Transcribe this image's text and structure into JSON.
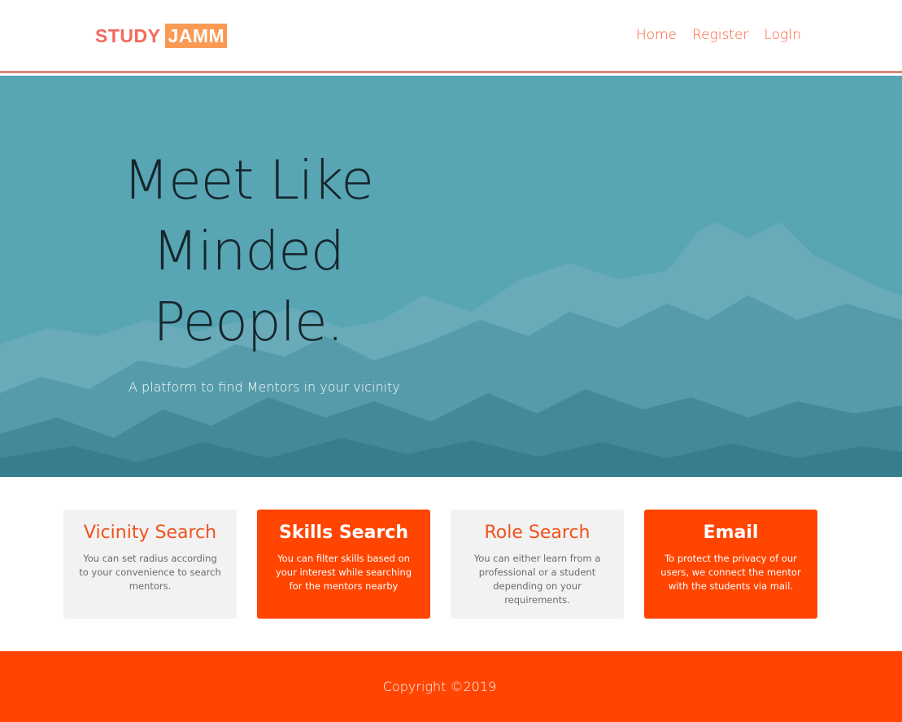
{
  "header": {
    "logo": {
      "part1": "STUDY",
      "part2": "JAMM"
    },
    "nav": [
      {
        "label": "Home"
      },
      {
        "label": "Register"
      },
      {
        "label": "LogIn"
      }
    ]
  },
  "hero": {
    "title_lines": [
      "Meet Like",
      "Minded",
      "People."
    ],
    "subtitle": "A platform to find Mentors in your vicinity"
  },
  "features": [
    {
      "title": "Vicinity Search",
      "text": "You can set radius according to your convenience to search mentors.",
      "style": "light"
    },
    {
      "title": "Skills Search",
      "text": "You can filter skills based on your interest while searching for the mentors nearby",
      "style": "orange"
    },
    {
      "title": "Role Search",
      "text": "You can either learn from a professional or a student depending on your requirements.",
      "style": "light"
    },
    {
      "title": "Email",
      "text": "To protect the privacy of our users, we connect the mentor with the students via mail.",
      "style": "orange"
    }
  ],
  "footer": {
    "copyright": "Copyright ©2019"
  },
  "colors": {
    "accent": "#ff4500",
    "hero_bg": "#58a5b4",
    "logo_study": "#f46a5c",
    "logo_jamm_bg": "#f99a55"
  }
}
